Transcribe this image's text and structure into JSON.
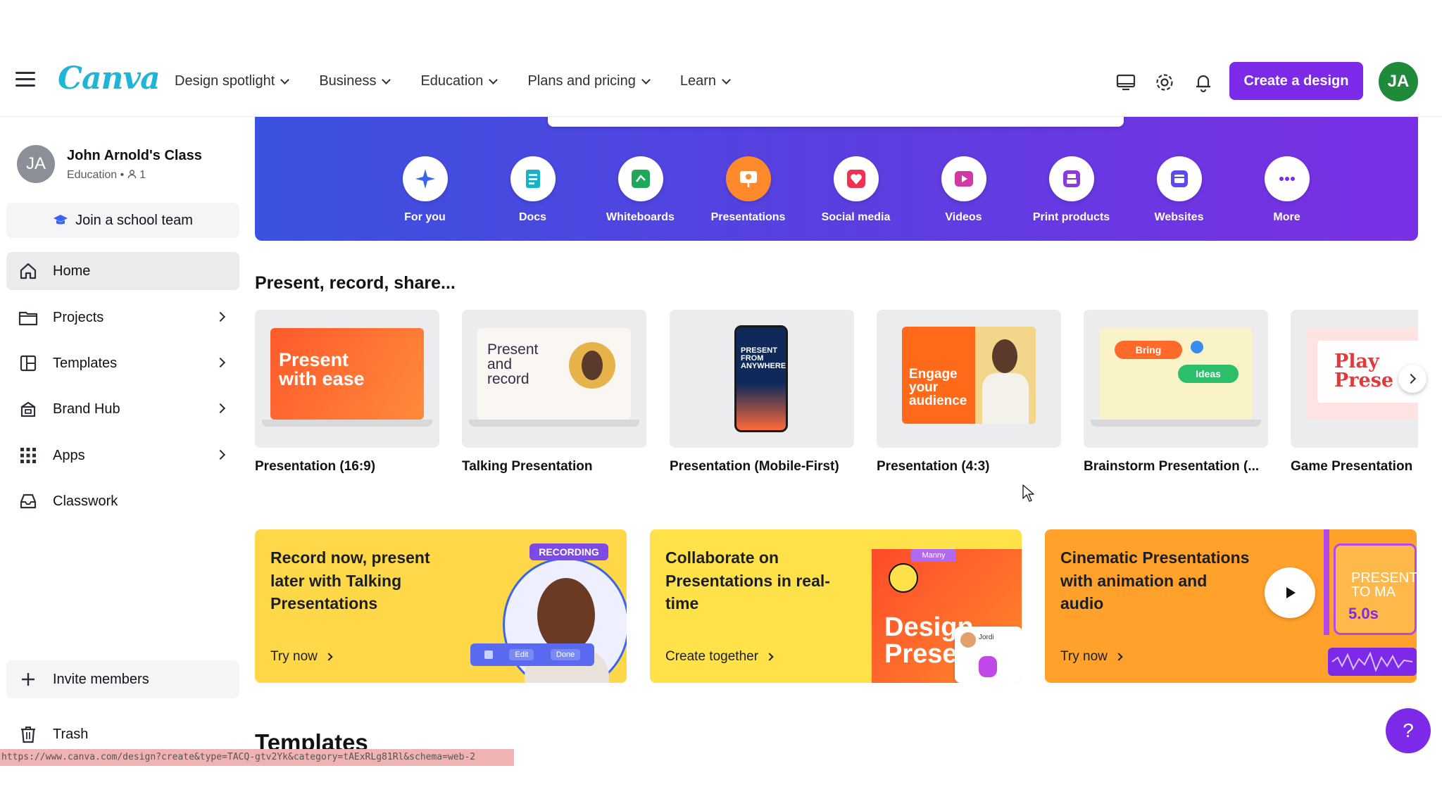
{
  "header": {
    "logo": "Canva",
    "nav": [
      {
        "label": "Design spotlight"
      },
      {
        "label": "Business"
      },
      {
        "label": "Education"
      },
      {
        "label": "Plans and pricing"
      },
      {
        "label": "Learn"
      }
    ],
    "create_button": "Create a design",
    "avatar_initials": "JA",
    "icons": [
      "monitor-icon",
      "gear-icon",
      "bell-icon"
    ]
  },
  "sidebar": {
    "team": {
      "initials": "JA",
      "name": "John Arnold's Class",
      "type": "Education",
      "members": "1"
    },
    "join_button": "Join a school team",
    "items": [
      {
        "label": "Home",
        "icon": "home-icon",
        "active": true
      },
      {
        "label": "Projects",
        "icon": "folder-icon"
      },
      {
        "label": "Templates",
        "icon": "layout-icon"
      },
      {
        "label": "Brand Hub",
        "icon": "brand-icon"
      },
      {
        "label": "Apps",
        "icon": "grid-icon"
      },
      {
        "label": "Classwork",
        "icon": "inbox-icon"
      }
    ],
    "invite": "Invite members",
    "trash": "Trash"
  },
  "categories": [
    {
      "label": "For you",
      "icon": "sparkle-icon",
      "color": "#3a64f0"
    },
    {
      "label": "Docs",
      "icon": "docs-icon",
      "color": "#16b3c7"
    },
    {
      "label": "Whiteboards",
      "icon": "whiteboard-icon",
      "color": "#1fa85a"
    },
    {
      "label": "Presentations",
      "icon": "presentation-icon",
      "color": "#ff8a2b",
      "selected": true
    },
    {
      "label": "Social media",
      "icon": "heart-icon",
      "color": "#f0324f"
    },
    {
      "label": "Videos",
      "icon": "video-icon",
      "color": "#d13aa4"
    },
    {
      "label": "Print products",
      "icon": "print-icon",
      "color": "#8a3ae0"
    },
    {
      "label": "Websites",
      "icon": "website-icon",
      "color": "#5b4be8"
    },
    {
      "label": "More",
      "icon": "more-icon",
      "color": "#7d2ae8"
    }
  ],
  "section_title": "Present, record, share...",
  "template_cards": [
    {
      "label": "Presentation (16:9)",
      "thumb_text": "Present with ease"
    },
    {
      "label": "Talking Presentation",
      "thumb_text": "Present and record"
    },
    {
      "label": "Presentation (Mobile-First)",
      "thumb_text": "PRESENT FROM ANYWHERE"
    },
    {
      "label": "Presentation (4:3)",
      "thumb_text": "Engage your audience"
    },
    {
      "label": "Brainstorm Presentation (...",
      "thumb_text_1": "Bring",
      "thumb_text_2": "Ideas"
    },
    {
      "label": "Game Presentation",
      "thumb_text": "Play Prese"
    }
  ],
  "promos": [
    {
      "title": "Record now, present later with Talking Presentations",
      "cta": "Try now",
      "badge": "RECORDING",
      "chip_1": "Edit",
      "chip_2": "Done"
    },
    {
      "title": "Collaborate on Presentations in real-time",
      "cta": "Create together",
      "badge": "Manny",
      "art_text": "Design Prese",
      "tile_name": "Jordi"
    },
    {
      "title": "Cinematic Presentations with animation and audio",
      "cta": "Try now",
      "art_text": "PRESENT TO MA",
      "timer": "5.0s"
    }
  ],
  "templates_heading": "Templates",
  "help_label": "?",
  "status_url": "https://www.canva.com/design?create&type=TACQ-gtv2Yk&category=tAExRLg81Rl&schema=web-2"
}
